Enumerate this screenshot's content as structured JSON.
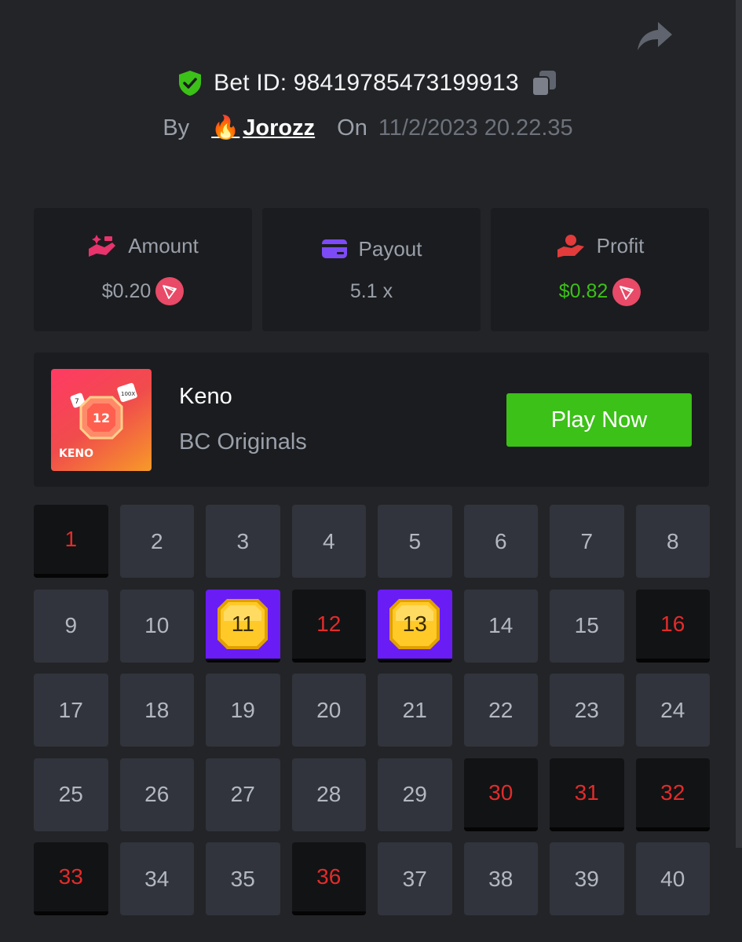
{
  "header": {
    "bet_id": "Bet ID: 98419785473199913",
    "by_label": "By",
    "user_emoji": "🔥",
    "username": "Jorozz",
    "on_label": "On",
    "date": "11/2/2023 20.22.35"
  },
  "stats": {
    "amount": {
      "label": "Amount",
      "value": "$0.20",
      "icon": "money-hand-icon"
    },
    "payout": {
      "label": "Payout",
      "value": "5.1 x",
      "icon": "card-icon"
    },
    "profit": {
      "label": "Profit",
      "value": "$0.82",
      "icon": "profit-hand-icon"
    }
  },
  "game": {
    "name": "Keno",
    "provider": "BC Originals",
    "play_label": "Play Now",
    "thumb_label": "KENO",
    "thumb_number": "12",
    "thumb_dice_left": "7",
    "thumb_dice_right": "100X"
  },
  "board": {
    "cells": [
      {
        "n": "1",
        "state": "miss"
      },
      {
        "n": "2",
        "state": "none"
      },
      {
        "n": "3",
        "state": "none"
      },
      {
        "n": "4",
        "state": "none"
      },
      {
        "n": "5",
        "state": "none"
      },
      {
        "n": "6",
        "state": "none"
      },
      {
        "n": "7",
        "state": "none"
      },
      {
        "n": "8",
        "state": "none"
      },
      {
        "n": "9",
        "state": "none"
      },
      {
        "n": "10",
        "state": "none"
      },
      {
        "n": "11",
        "state": "hit"
      },
      {
        "n": "12",
        "state": "miss"
      },
      {
        "n": "13",
        "state": "hit"
      },
      {
        "n": "14",
        "state": "none"
      },
      {
        "n": "15",
        "state": "none"
      },
      {
        "n": "16",
        "state": "miss"
      },
      {
        "n": "17",
        "state": "none"
      },
      {
        "n": "18",
        "state": "none"
      },
      {
        "n": "19",
        "state": "none"
      },
      {
        "n": "20",
        "state": "none"
      },
      {
        "n": "21",
        "state": "none"
      },
      {
        "n": "22",
        "state": "none"
      },
      {
        "n": "23",
        "state": "none"
      },
      {
        "n": "24",
        "state": "none"
      },
      {
        "n": "25",
        "state": "none"
      },
      {
        "n": "26",
        "state": "none"
      },
      {
        "n": "27",
        "state": "none"
      },
      {
        "n": "28",
        "state": "none"
      },
      {
        "n": "29",
        "state": "none"
      },
      {
        "n": "30",
        "state": "miss"
      },
      {
        "n": "31",
        "state": "miss"
      },
      {
        "n": "32",
        "state": "miss"
      },
      {
        "n": "33",
        "state": "miss"
      },
      {
        "n": "34",
        "state": "none"
      },
      {
        "n": "35",
        "state": "none"
      },
      {
        "n": "36",
        "state": "miss"
      },
      {
        "n": "37",
        "state": "none"
      },
      {
        "n": "38",
        "state": "none"
      },
      {
        "n": "39",
        "state": "none"
      },
      {
        "n": "40",
        "state": "none"
      }
    ]
  },
  "colors": {
    "accent_green": "#3bc117",
    "hit_purple": "#6a1cf5",
    "miss_red": "#e22b2b",
    "coin_red": "#e84a67"
  }
}
